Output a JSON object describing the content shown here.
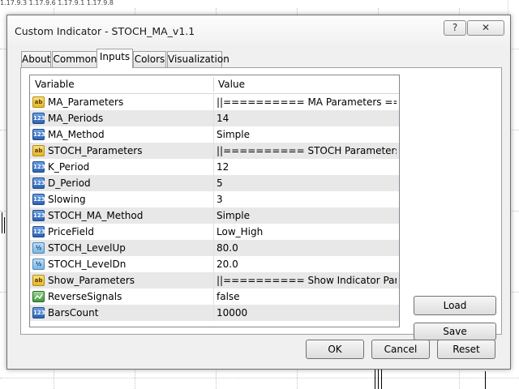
{
  "background": {
    "header_text": "1.17.9.3 1.17.9.6 1.17.9.1 1.17.9.8"
  },
  "dialog": {
    "title": "Custom Indicator - STOCH_MA_v1.1",
    "help_label": "?",
    "close_label": "✕"
  },
  "tabs": [
    {
      "label": "About"
    },
    {
      "label": "Common"
    },
    {
      "label": "Inputs"
    },
    {
      "label": "Colors"
    },
    {
      "label": "Visualization"
    }
  ],
  "grid": {
    "col_variable": "Variable",
    "col_value": "Value",
    "rows": [
      {
        "icon": "ab",
        "variable": "MA_Parameters",
        "value": "||========== MA Parameters ==========||"
      },
      {
        "icon": "123",
        "variable": "MA_Periods",
        "value": "14"
      },
      {
        "icon": "123",
        "variable": "MA_Method",
        "value": "Simple"
      },
      {
        "icon": "ab",
        "variable": "STOCH_Parameters",
        "value": "||========== STOCH Parameters ========..."
      },
      {
        "icon": "123",
        "variable": "K_Period",
        "value": "12"
      },
      {
        "icon": "123",
        "variable": "D_Period",
        "value": "5"
      },
      {
        "icon": "123",
        "variable": "Slowing",
        "value": "3"
      },
      {
        "icon": "123",
        "variable": "STOCH_MA_Method",
        "value": "Simple"
      },
      {
        "icon": "123",
        "variable": "PriceField",
        "value": "Low_High"
      },
      {
        "icon": "½",
        "variable": "STOCH_LevelUp",
        "value": "80.0"
      },
      {
        "icon": "½",
        "variable": "STOCH_LevelDn",
        "value": "20.0"
      },
      {
        "icon": "ab",
        "variable": "Show_Parameters",
        "value": "||========== Show Indicator Parameters ==..."
      },
      {
        "icon": "bool",
        "variable": "ReverseSignals",
        "value": "false"
      },
      {
        "icon": "123",
        "variable": "BarsCount",
        "value": "10000"
      }
    ]
  },
  "buttons": {
    "load": "Load",
    "save": "Save",
    "ok": "OK",
    "cancel": "Cancel",
    "reset": "Reset"
  }
}
